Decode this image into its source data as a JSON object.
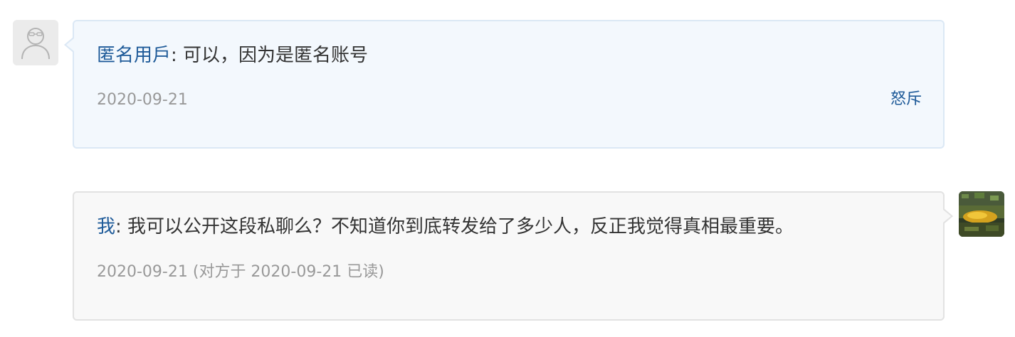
{
  "messages": [
    {
      "sender": "匿名用戶",
      "separator": ":",
      "text": "可以，因为是匿名账号",
      "date": "2020-09-21",
      "action": "怒斥",
      "avatar_icon": "anonymous-user-icon"
    },
    {
      "sender": "我",
      "separator": ":",
      "text": "我可以公开这段私聊么？不知道你到底转发给了多少人，反正我觉得真相最重要。",
      "date": "2020-09-21",
      "read_status": "(对方于 2020-09-21 已读)",
      "avatar_icon": "user-photo-avatar"
    }
  ],
  "colors": {
    "link": "#1f5b99",
    "incoming_bg": "#f3f8fd",
    "incoming_border": "#dbe8f5",
    "outgoing_bg": "#f8f8f8",
    "outgoing_border": "#e2e2e2",
    "meta_text": "#999999"
  }
}
